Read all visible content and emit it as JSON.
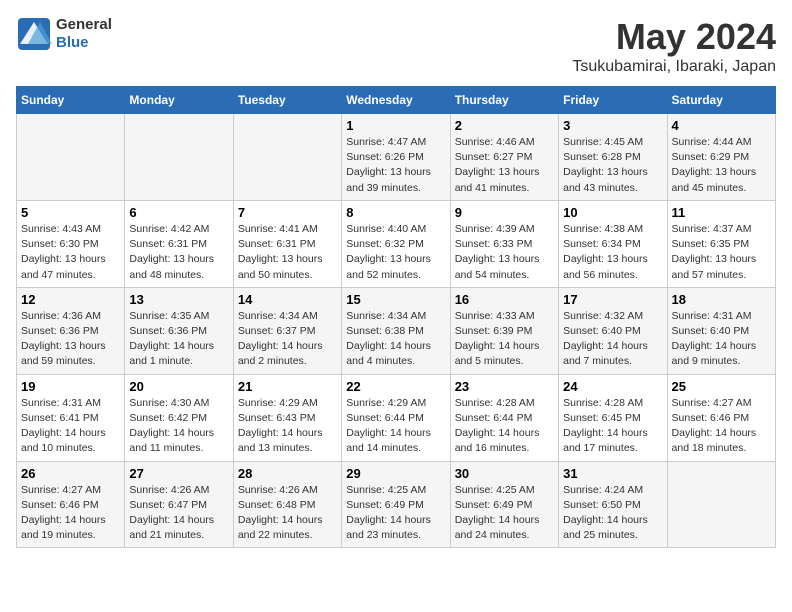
{
  "header": {
    "logo_general": "General",
    "logo_blue": "Blue",
    "title": "May 2024",
    "subtitle": "Tsukubamirai, Ibaraki, Japan"
  },
  "days_of_week": [
    "Sunday",
    "Monday",
    "Tuesday",
    "Wednesday",
    "Thursday",
    "Friday",
    "Saturday"
  ],
  "weeks": [
    [
      {
        "day": "",
        "info": ""
      },
      {
        "day": "",
        "info": ""
      },
      {
        "day": "",
        "info": ""
      },
      {
        "day": "1",
        "info": "Sunrise: 4:47 AM\nSunset: 6:26 PM\nDaylight: 13 hours\nand 39 minutes."
      },
      {
        "day": "2",
        "info": "Sunrise: 4:46 AM\nSunset: 6:27 PM\nDaylight: 13 hours\nand 41 minutes."
      },
      {
        "day": "3",
        "info": "Sunrise: 4:45 AM\nSunset: 6:28 PM\nDaylight: 13 hours\nand 43 minutes."
      },
      {
        "day": "4",
        "info": "Sunrise: 4:44 AM\nSunset: 6:29 PM\nDaylight: 13 hours\nand 45 minutes."
      }
    ],
    [
      {
        "day": "5",
        "info": "Sunrise: 4:43 AM\nSunset: 6:30 PM\nDaylight: 13 hours\nand 47 minutes."
      },
      {
        "day": "6",
        "info": "Sunrise: 4:42 AM\nSunset: 6:31 PM\nDaylight: 13 hours\nand 48 minutes."
      },
      {
        "day": "7",
        "info": "Sunrise: 4:41 AM\nSunset: 6:31 PM\nDaylight: 13 hours\nand 50 minutes."
      },
      {
        "day": "8",
        "info": "Sunrise: 4:40 AM\nSunset: 6:32 PM\nDaylight: 13 hours\nand 52 minutes."
      },
      {
        "day": "9",
        "info": "Sunrise: 4:39 AM\nSunset: 6:33 PM\nDaylight: 13 hours\nand 54 minutes."
      },
      {
        "day": "10",
        "info": "Sunrise: 4:38 AM\nSunset: 6:34 PM\nDaylight: 13 hours\nand 56 minutes."
      },
      {
        "day": "11",
        "info": "Sunrise: 4:37 AM\nSunset: 6:35 PM\nDaylight: 13 hours\nand 57 minutes."
      }
    ],
    [
      {
        "day": "12",
        "info": "Sunrise: 4:36 AM\nSunset: 6:36 PM\nDaylight: 13 hours\nand 59 minutes."
      },
      {
        "day": "13",
        "info": "Sunrise: 4:35 AM\nSunset: 6:36 PM\nDaylight: 14 hours\nand 1 minute."
      },
      {
        "day": "14",
        "info": "Sunrise: 4:34 AM\nSunset: 6:37 PM\nDaylight: 14 hours\nand 2 minutes."
      },
      {
        "day": "15",
        "info": "Sunrise: 4:34 AM\nSunset: 6:38 PM\nDaylight: 14 hours\nand 4 minutes."
      },
      {
        "day": "16",
        "info": "Sunrise: 4:33 AM\nSunset: 6:39 PM\nDaylight: 14 hours\nand 5 minutes."
      },
      {
        "day": "17",
        "info": "Sunrise: 4:32 AM\nSunset: 6:40 PM\nDaylight: 14 hours\nand 7 minutes."
      },
      {
        "day": "18",
        "info": "Sunrise: 4:31 AM\nSunset: 6:40 PM\nDaylight: 14 hours\nand 9 minutes."
      }
    ],
    [
      {
        "day": "19",
        "info": "Sunrise: 4:31 AM\nSunset: 6:41 PM\nDaylight: 14 hours\nand 10 minutes."
      },
      {
        "day": "20",
        "info": "Sunrise: 4:30 AM\nSunset: 6:42 PM\nDaylight: 14 hours\nand 11 minutes."
      },
      {
        "day": "21",
        "info": "Sunrise: 4:29 AM\nSunset: 6:43 PM\nDaylight: 14 hours\nand 13 minutes."
      },
      {
        "day": "22",
        "info": "Sunrise: 4:29 AM\nSunset: 6:44 PM\nDaylight: 14 hours\nand 14 minutes."
      },
      {
        "day": "23",
        "info": "Sunrise: 4:28 AM\nSunset: 6:44 PM\nDaylight: 14 hours\nand 16 minutes."
      },
      {
        "day": "24",
        "info": "Sunrise: 4:28 AM\nSunset: 6:45 PM\nDaylight: 14 hours\nand 17 minutes."
      },
      {
        "day": "25",
        "info": "Sunrise: 4:27 AM\nSunset: 6:46 PM\nDaylight: 14 hours\nand 18 minutes."
      }
    ],
    [
      {
        "day": "26",
        "info": "Sunrise: 4:27 AM\nSunset: 6:46 PM\nDaylight: 14 hours\nand 19 minutes."
      },
      {
        "day": "27",
        "info": "Sunrise: 4:26 AM\nSunset: 6:47 PM\nDaylight: 14 hours\nand 21 minutes."
      },
      {
        "day": "28",
        "info": "Sunrise: 4:26 AM\nSunset: 6:48 PM\nDaylight: 14 hours\nand 22 minutes."
      },
      {
        "day": "29",
        "info": "Sunrise: 4:25 AM\nSunset: 6:49 PM\nDaylight: 14 hours\nand 23 minutes."
      },
      {
        "day": "30",
        "info": "Sunrise: 4:25 AM\nSunset: 6:49 PM\nDaylight: 14 hours\nand 24 minutes."
      },
      {
        "day": "31",
        "info": "Sunrise: 4:24 AM\nSunset: 6:50 PM\nDaylight: 14 hours\nand 25 minutes."
      },
      {
        "day": "",
        "info": ""
      }
    ]
  ]
}
